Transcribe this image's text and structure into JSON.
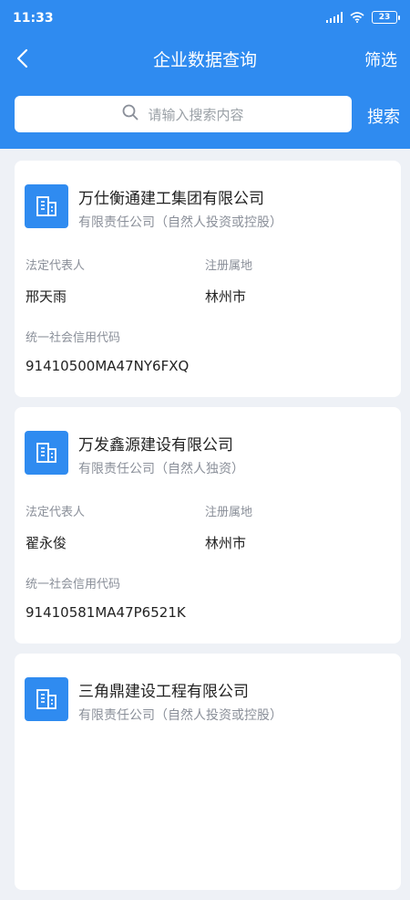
{
  "status": {
    "time": "11:33",
    "battery": "23"
  },
  "nav": {
    "title": "企业数据查询",
    "filter_label": "筛选"
  },
  "search": {
    "placeholder": "请输入搜索内容",
    "button_label": "搜索"
  },
  "labels": {
    "legal_rep": "法定代表人",
    "registered_location": "注册属地",
    "credit_code": "统一社会信用代码"
  },
  "companies": [
    {
      "name": "万仕衡通建工集团有限公司",
      "type": "有限责任公司（自然人投资或控股）",
      "legal_rep": "邢天雨",
      "location": "林州市",
      "code": "91410500MA47NY6FXQ"
    },
    {
      "name": "万发鑫源建设有限公司",
      "type": "有限责任公司（自然人独资）",
      "legal_rep": "翟永俊",
      "location": "林州市",
      "code": "91410581MA47P6521K"
    },
    {
      "name": "三角鼎建设工程有限公司",
      "type": "有限责任公司（自然人投资或控股）",
      "legal_rep": "",
      "location": "",
      "code": ""
    }
  ],
  "colors": {
    "primary": "#2f8bf0",
    "background": "#eef1f6"
  }
}
